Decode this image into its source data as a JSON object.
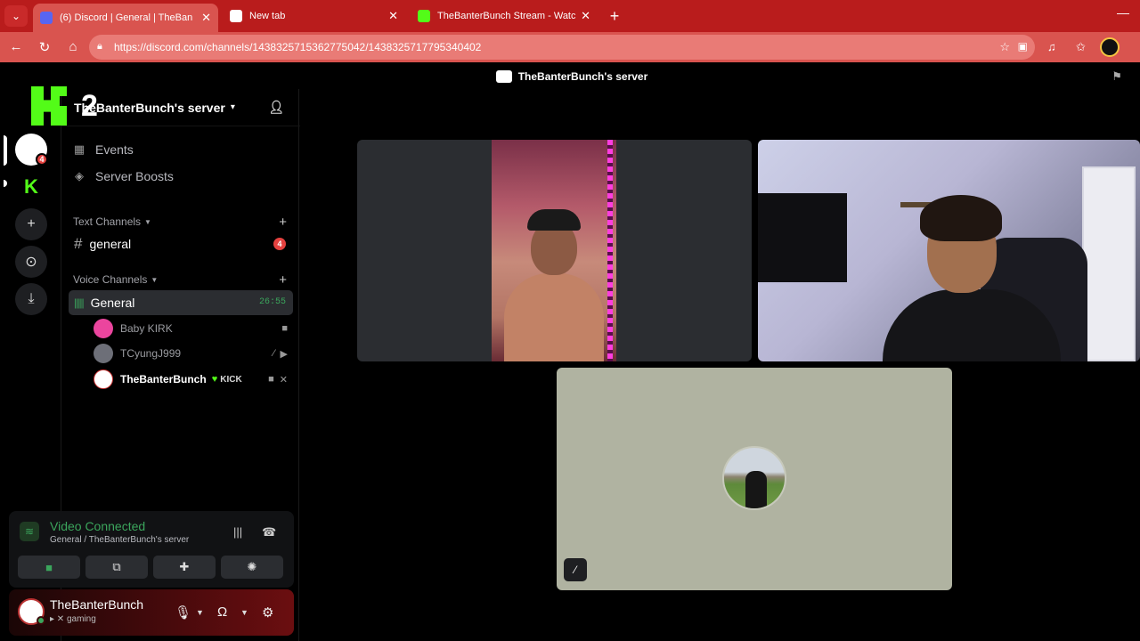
{
  "browser": {
    "tabs": [
      {
        "title": "(6) Discord | General | TheBan",
        "fav_color": "#5865f2",
        "active": true
      },
      {
        "title": "New tab",
        "fav_color": "#ffffff",
        "active": false
      },
      {
        "title": "TheBanterBunch Stream - Watch L",
        "fav_color": "#53fc18",
        "active": false
      }
    ],
    "url": "https://discord.com/channels/1438325715362775042/1438325717795340402"
  },
  "discord": {
    "window_title": "TheBanterBunch's server",
    "overlay_number": "2",
    "rail": {
      "server_badge": "4"
    },
    "server_name": "TheBanterBunch's server",
    "nav": [
      {
        "label": "Events",
        "icon": "calendar-icon"
      },
      {
        "label": "Server Boosts",
        "icon": "boost-icon"
      }
    ],
    "text_category": "Text Channels",
    "text_channels": [
      {
        "name": "general",
        "badge": "4"
      }
    ],
    "voice_category": "Voice Channels",
    "voice_channel": {
      "name": "General",
      "timer": "26:55"
    },
    "voice_users": [
      {
        "name": "Baby KIRK",
        "avatar_color": "#eb459e"
      },
      {
        "name": "TCyungJ999",
        "avatar_color": "#6d6f78"
      },
      {
        "name": "TheBanterBunch",
        "avatar_color": "#ffffff",
        "tag": "KICK"
      }
    ],
    "voice_panel": {
      "status": "Video Connected",
      "sub": "General / TheBanterBunch's server"
    },
    "user": {
      "name": "TheBanterBunch",
      "status": "gaming"
    }
  },
  "colors": {
    "accent_green": "#3ba55c",
    "kick_green": "#53fc18",
    "browser_red": "#b91c1c"
  }
}
